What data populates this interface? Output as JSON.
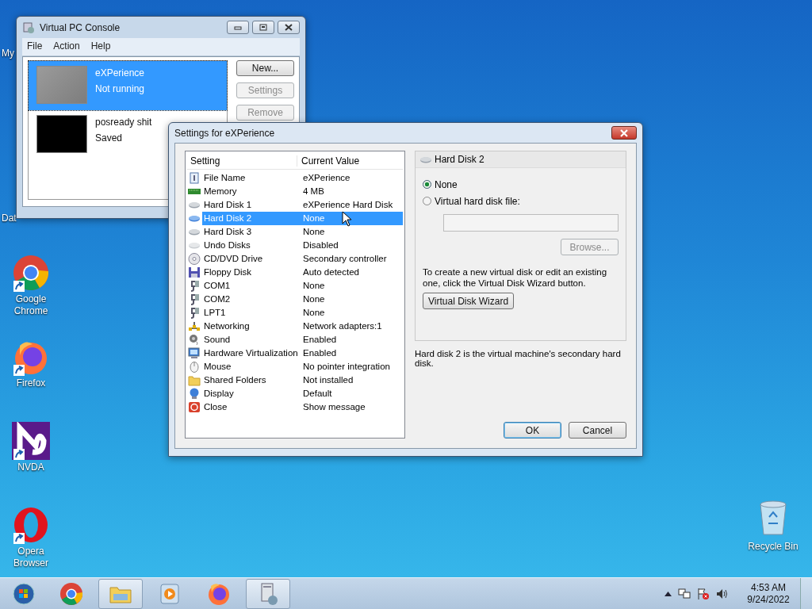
{
  "desktop": {
    "partial_labels": [
      "My",
      "Dat"
    ],
    "icons": [
      {
        "kind": "chrome",
        "label": "Google Chrome"
      },
      {
        "kind": "firefox",
        "label": "Firefox"
      },
      {
        "kind": "nvda",
        "label": "NVDA"
      },
      {
        "kind": "opera",
        "label": "Opera Browser"
      }
    ],
    "recycle_bin": {
      "label": "Recycle Bin"
    }
  },
  "console_window": {
    "title": "Virtual PC Console",
    "menu": [
      "File",
      "Action",
      "Help"
    ],
    "machines": [
      {
        "name": "eXPerience",
        "status": "Not running",
        "selected": true
      },
      {
        "name": "posready shit",
        "status": "Saved",
        "selected": false
      }
    ],
    "buttons": [
      {
        "label": "New...",
        "disabled": false
      },
      {
        "label": "Settings",
        "disabled": true
      },
      {
        "label": "Remove",
        "disabled": true
      }
    ]
  },
  "settings_dialog": {
    "title": "Settings for eXPerience",
    "columns": [
      "Setting",
      "Current Value"
    ],
    "rows": [
      {
        "setting": "File Name",
        "value": "eXPerience",
        "selected": false
      },
      {
        "setting": "Memory",
        "value": "4 MB",
        "selected": false
      },
      {
        "setting": "Hard Disk 1",
        "value": "eXPerience Hard Disk",
        "selected": false
      },
      {
        "setting": "Hard Disk 2",
        "value": "None",
        "selected": true
      },
      {
        "setting": "Hard Disk 3",
        "value": "None",
        "selected": false
      },
      {
        "setting": "Undo Disks",
        "value": "Disabled",
        "selected": false
      },
      {
        "setting": "CD/DVD Drive",
        "value": "Secondary controller",
        "selected": false
      },
      {
        "setting": "Floppy Disk",
        "value": "Auto detected",
        "selected": false
      },
      {
        "setting": "COM1",
        "value": "None",
        "selected": false
      },
      {
        "setting": "COM2",
        "value": "None",
        "selected": false
      },
      {
        "setting": "LPT1",
        "value": "None",
        "selected": false
      },
      {
        "setting": "Networking",
        "value": "Network adapters:1",
        "selected": false
      },
      {
        "setting": "Sound",
        "value": "Enabled",
        "selected": false
      },
      {
        "setting": "Hardware Virtualization",
        "value": "Enabled",
        "selected": false
      },
      {
        "setting": "Mouse",
        "value": "No pointer integration",
        "selected": false
      },
      {
        "setting": "Shared Folders",
        "value": "Not installed",
        "selected": false
      },
      {
        "setting": "Display",
        "value": "Default",
        "selected": false
      },
      {
        "setting": "Close",
        "value": "Show message",
        "selected": false
      }
    ],
    "panel": {
      "title": "Hard Disk 2",
      "options": [
        {
          "label": "None",
          "selected": true
        },
        {
          "label": "Virtual hard disk file:",
          "selected": false
        }
      ],
      "file_field": {
        "disabled": true
      },
      "browse_button": {
        "label": "Browse...",
        "disabled": true
      },
      "help_text": "To create a new virtual disk or edit an existing one, click the Virtual Disk Wizard button.",
      "wizard_button": {
        "label": "Virtual Disk Wizard"
      }
    },
    "description": "Hard disk 2 is the virtual machine's secondary hard disk.",
    "buttons": [
      {
        "label": "OK",
        "default": true
      },
      {
        "label": "Cancel",
        "default": false
      }
    ]
  },
  "taskbar": {
    "items": [
      {
        "kind": "chrome",
        "active": false
      },
      {
        "kind": "explorer",
        "active": true
      },
      {
        "kind": "media",
        "active": false
      },
      {
        "kind": "firefox",
        "active": false
      },
      {
        "kind": "virtualpc",
        "active": true
      }
    ],
    "time": "4:53 AM",
    "date": "9/24/2022"
  }
}
